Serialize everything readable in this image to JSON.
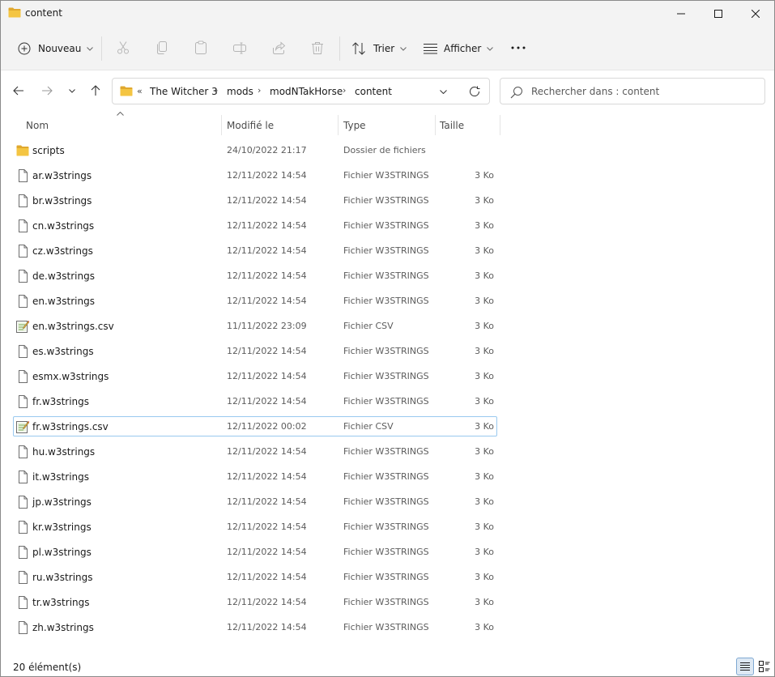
{
  "window": {
    "title": "content",
    "controls": {
      "minimize": "minimize",
      "maximize": "maximize",
      "close": "close"
    }
  },
  "toolbar": {
    "new_label": "Nouveau",
    "sort_label": "Trier",
    "view_label": "Afficher",
    "icons": [
      "new-icon",
      "cut-icon",
      "copy-icon",
      "paste-icon",
      "rename-icon",
      "share-icon",
      "delete-icon",
      "sort-icon",
      "view-icon",
      "more-icon"
    ]
  },
  "address": {
    "lead": "«",
    "crumbs": [
      "The Witcher 3",
      "mods",
      "modNTakHorse",
      "content"
    ],
    "separator": "›"
  },
  "search": {
    "placeholder": "Rechercher dans : content",
    "value": ""
  },
  "columns": {
    "name": "Nom",
    "modified": "Modifié le",
    "type": "Type",
    "size": "Taille",
    "sorted_by": "Nom"
  },
  "files": [
    {
      "name": "scripts",
      "modified": "24/10/2022 21:17",
      "type": "Dossier de fichiers",
      "size": "",
      "icon": "folder-icon"
    },
    {
      "name": "ar.w3strings",
      "modified": "12/11/2022 14:54",
      "type": "Fichier W3STRINGS",
      "size": "3 Ko",
      "icon": "file-icon"
    },
    {
      "name": "br.w3strings",
      "modified": "12/11/2022 14:54",
      "type": "Fichier W3STRINGS",
      "size": "3 Ko",
      "icon": "file-icon"
    },
    {
      "name": "cn.w3strings",
      "modified": "12/11/2022 14:54",
      "type": "Fichier W3STRINGS",
      "size": "3 Ko",
      "icon": "file-icon"
    },
    {
      "name": "cz.w3strings",
      "modified": "12/11/2022 14:54",
      "type": "Fichier W3STRINGS",
      "size": "3 Ko",
      "icon": "file-icon"
    },
    {
      "name": "de.w3strings",
      "modified": "12/11/2022 14:54",
      "type": "Fichier W3STRINGS",
      "size": "3 Ko",
      "icon": "file-icon"
    },
    {
      "name": "en.w3strings",
      "modified": "12/11/2022 14:54",
      "type": "Fichier W3STRINGS",
      "size": "3 Ko",
      "icon": "file-icon"
    },
    {
      "name": "en.w3strings.csv",
      "modified": "11/11/2022 23:09",
      "type": "Fichier CSV",
      "size": "3 Ko",
      "icon": "csv-file-icon"
    },
    {
      "name": "es.w3strings",
      "modified": "12/11/2022 14:54",
      "type": "Fichier W3STRINGS",
      "size": "3 Ko",
      "icon": "file-icon"
    },
    {
      "name": "esmx.w3strings",
      "modified": "12/11/2022 14:54",
      "type": "Fichier W3STRINGS",
      "size": "3 Ko",
      "icon": "file-icon"
    },
    {
      "name": "fr.w3strings",
      "modified": "12/11/2022 14:54",
      "type": "Fichier W3STRINGS",
      "size": "3 Ko",
      "icon": "file-icon"
    },
    {
      "name": "fr.w3strings.csv",
      "modified": "12/11/2022 00:02",
      "type": "Fichier CSV",
      "size": "3 Ko",
      "icon": "csv-file-icon",
      "focused": true
    },
    {
      "name": "hu.w3strings",
      "modified": "12/11/2022 14:54",
      "type": "Fichier W3STRINGS",
      "size": "3 Ko",
      "icon": "file-icon"
    },
    {
      "name": "it.w3strings",
      "modified": "12/11/2022 14:54",
      "type": "Fichier W3STRINGS",
      "size": "3 Ko",
      "icon": "file-icon"
    },
    {
      "name": "jp.w3strings",
      "modified": "12/11/2022 14:54",
      "type": "Fichier W3STRINGS",
      "size": "3 Ko",
      "icon": "file-icon"
    },
    {
      "name": "kr.w3strings",
      "modified": "12/11/2022 14:54",
      "type": "Fichier W3STRINGS",
      "size": "3 Ko",
      "icon": "file-icon"
    },
    {
      "name": "pl.w3strings",
      "modified": "12/11/2022 14:54",
      "type": "Fichier W3STRINGS",
      "size": "3 Ko",
      "icon": "file-icon"
    },
    {
      "name": "ru.w3strings",
      "modified": "12/11/2022 14:54",
      "type": "Fichier W3STRINGS",
      "size": "3 Ko",
      "icon": "file-icon"
    },
    {
      "name": "tr.w3strings",
      "modified": "12/11/2022 14:54",
      "type": "Fichier W3STRINGS",
      "size": "3 Ko",
      "icon": "file-icon"
    },
    {
      "name": "zh.w3strings",
      "modified": "12/11/2022 14:54",
      "type": "Fichier W3STRINGS",
      "size": "3 Ko",
      "icon": "file-icon"
    }
  ],
  "status": {
    "count_text": "20 élément(s)",
    "view_modes": [
      "details-view-icon",
      "tiles-view-icon"
    ]
  },
  "colors": {
    "folder": "#f4c542",
    "folder_dark": "#e0a82e",
    "accent": "#0067c0",
    "focus_border": "#99c9ef",
    "chrome": "#f3f3f3"
  }
}
